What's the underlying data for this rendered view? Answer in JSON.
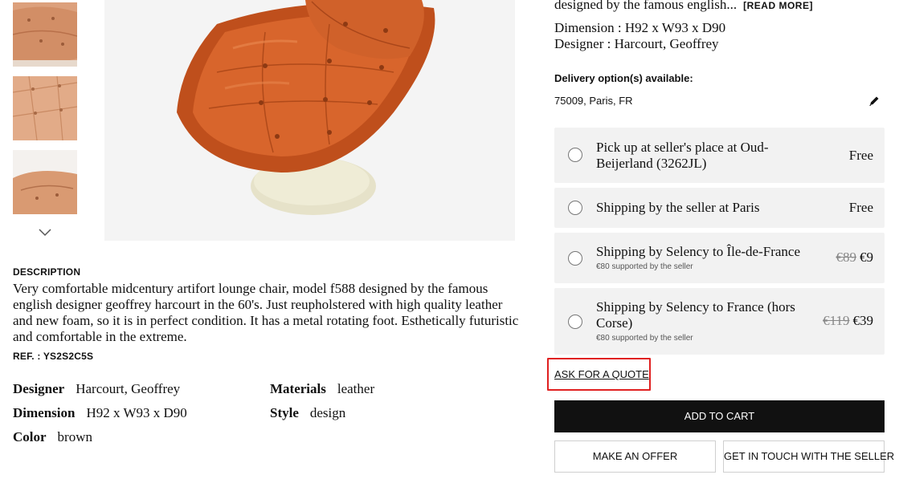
{
  "gallery": {
    "thumbnails": [
      "product-photo-cushion-detail",
      "product-photo-tufting-detail",
      "product-photo-seat-detail"
    ],
    "next_icon": "chevron-down-icon",
    "main_image": "lounge-chair-photo"
  },
  "description": {
    "heading": "DESCRIPTION",
    "text": "Very comfortable midcentury artifort lounge chair, model f588 designed by the famous english designer geoffrey harcourt in the 60's. Just reupholstered with high quality leather and new foam, so it is in perfect condition. It has a metal rotating foot. Esthetically futuristic and comfortable in the extreme.",
    "ref": "REF. : YS2S2C5S"
  },
  "attributes": [
    {
      "label": "Designer",
      "value": "Harcourt, Geoffrey"
    },
    {
      "label": "Dimension",
      "value": "H92 x W93 x D90"
    },
    {
      "label": "Color",
      "value": "brown"
    },
    {
      "label": "Materials",
      "value": "leather"
    },
    {
      "label": "Style",
      "value": "design"
    }
  ],
  "summary": {
    "excerpt": "designed by the famous english...",
    "read_more": "[READ MORE]",
    "dimension_line": "Dimension : H92 x W93 x D90",
    "designer_line": "Designer : Harcourt, Geoffrey"
  },
  "delivery": {
    "title": "Delivery option(s) available:",
    "location": "75009, Paris, FR",
    "edit_icon": "pencil-icon",
    "options": [
      {
        "label": "Pick up at seller's place at Oud-Beijerland (3262JL)",
        "price": "Free"
      },
      {
        "label": "Shipping by the seller at Paris",
        "price": "Free"
      },
      {
        "label": "Shipping by Selency to Île-de-France",
        "sub": "€80 supported by the seller",
        "old_price": "€89",
        "price": "€9"
      },
      {
        "label": "Shipping by Selency to France (hors Corse)",
        "sub": "€80 supported by the seller",
        "old_price": "€119",
        "price": "€39"
      }
    ]
  },
  "actions": {
    "ask_quote": "ASK FOR A QUOTE",
    "add_to_cart": "ADD TO CART",
    "make_offer": "MAKE AN OFFER",
    "contact_seller": "GET IN TOUCH WITH THE SELLER"
  },
  "colors": {
    "accent_highlight": "#e02020",
    "leather": "#cc5a22",
    "button_dark": "#111111"
  }
}
